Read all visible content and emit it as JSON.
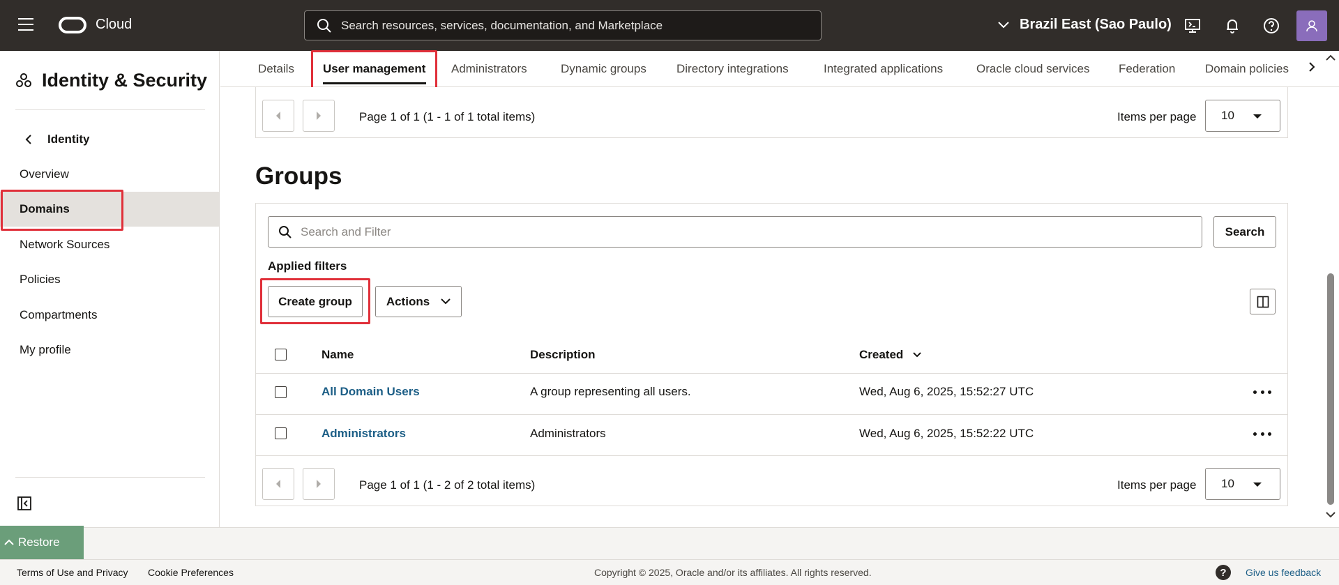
{
  "header": {
    "app_name": "Cloud",
    "search_placeholder": "Search resources, services, documentation, and Marketplace",
    "region": "Brazil East (Sao Paulo)",
    "icons": [
      "menu-icon",
      "cloud-shell-icon",
      "bell-icon",
      "help-icon",
      "user-avatar-icon"
    ]
  },
  "sidebar": {
    "title": "Identity & Security",
    "back_label": "Identity",
    "items": [
      {
        "label": "Overview",
        "active": false
      },
      {
        "label": "Domains",
        "active": true
      },
      {
        "label": "Network Sources",
        "active": false
      },
      {
        "label": "Policies",
        "active": false
      },
      {
        "label": "Compartments",
        "active": false
      },
      {
        "label": "My profile",
        "active": false
      }
    ]
  },
  "tabs": [
    {
      "label": "Details",
      "active": false
    },
    {
      "label": "User management",
      "active": true
    },
    {
      "label": "Administrators",
      "active": false
    },
    {
      "label": "Dynamic groups",
      "active": false
    },
    {
      "label": "Directory integrations",
      "active": false
    },
    {
      "label": "Integrated applications",
      "active": false
    },
    {
      "label": "Oracle cloud services",
      "active": false
    },
    {
      "label": "Federation",
      "active": false
    },
    {
      "label": "Domain policies",
      "active": false
    }
  ],
  "users_pager": {
    "text": "Page 1 of 1 (1 - 1 of 1 total items)",
    "items_per_page_label": "Items per page",
    "items_per_page": "10"
  },
  "groups": {
    "title": "Groups",
    "filter_placeholder": "Search and Filter",
    "search_button": "Search",
    "applied_filters": "Applied filters",
    "create_button": "Create group",
    "actions_button": "Actions",
    "columns": {
      "name": "Name",
      "description": "Description",
      "created": "Created"
    },
    "rows": [
      {
        "name": "All Domain Users",
        "description": "A group representing all users.",
        "created": "Wed, Aug 6, 2025, 15:52:27 UTC"
      },
      {
        "name": "Administrators",
        "description": "Administrators",
        "created": "Wed, Aug 6, 2025, 15:52:22 UTC"
      }
    ],
    "pager": {
      "text": "Page 1 of 1 (1 - 2 of 2 total items)",
      "items_per_page_label": "Items per page",
      "items_per_page": "10"
    }
  },
  "restore_label": "Restore",
  "footer": {
    "terms": "Terms of Use and Privacy",
    "cookies": "Cookie Preferences",
    "copyright": "Copyright © 2025, Oracle and/or its affiliates. All rights reserved.",
    "feedback": "Give us feedback"
  },
  "colors": {
    "topbar": "#312d2a",
    "highlight": "#e0303a",
    "link": "#1c5e86",
    "restore": "#6b9e7a"
  }
}
